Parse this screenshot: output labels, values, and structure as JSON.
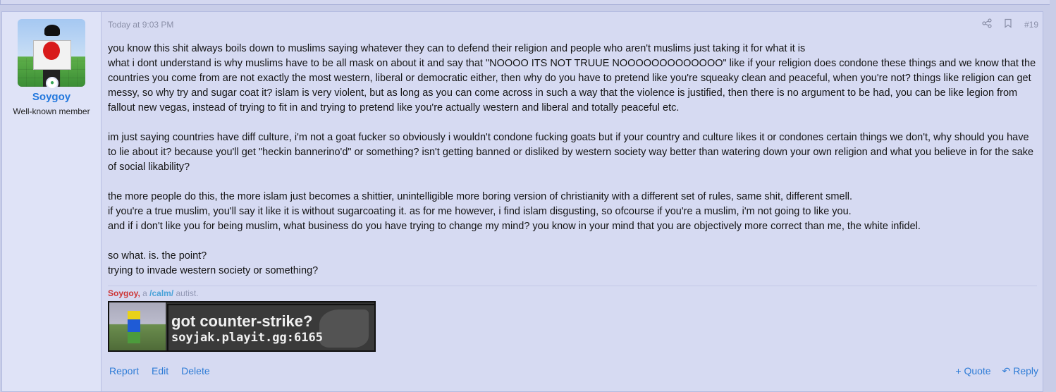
{
  "post": {
    "time": "Today at 9:03 PM",
    "number": "#19",
    "author": {
      "username": "Soygoy",
      "title": "Well-known member"
    },
    "paragraphs": [
      "you know this shit always boils down to muslims saying whatever they can to defend their religion and people who aren't muslims just taking it for what it is",
      "what i dont understand is why muslims have to be all mask on about it and say that \"NOOOO ITS NOT TRUUE NOOOOOOOOOOOOO\" like if your religion does condone these things and we know that the countries you come from are not exactly the most western, liberal or democratic either, then why do you have to pretend like you're squeaky clean and peaceful, when you're not? things like religion can get messy, so why try and sugar coat it? islam is very violent, but as long as you can come across in such a way that the violence is justified, then there is no argument to be had, you can be like legion from fallout new vegas, instead of trying to fit in and trying to pretend like you're actually western and liberal and totally peaceful etc.",
      "",
      "im just saying countries have diff culture, i'm not a goat fucker so obviously i wouldn't condone fucking goats but if your country and culture likes it or condones certain things we don't, why should you have to lie about it? because you'll get \"heckin bannerino'd\" or something? isn't getting banned or disliked by western society way better than watering down your own religion and what you believe in for the sake of social likability?",
      "",
      "the more people do this, the more islam just becomes a shittier, unintelligible more boring version of christianity with a different set of rules, same shit, different smell.",
      "if you're a true muslim, you'll say it like it is without sugarcoating it. as for me however, i find islam disgusting, so ofcourse if you're a muslim, i'm not going to like you.",
      "and if i don't like you for being muslim, what business do you have trying to change my mind? you know in your mind that you are objectively more correct than me, the white infidel.",
      "",
      "so what. is. the point?",
      "trying to invade western society or something?"
    ],
    "signature": {
      "name": "Soygoy,",
      "mid": " a ",
      "link": "/calm/",
      "tail": " autist.",
      "banner_line1": "got counter-strike?",
      "banner_line2": "soyjak.playit.gg:6165"
    },
    "actions": {
      "report": "Report",
      "edit": "Edit",
      "delete": "Delete",
      "quote": "Quote",
      "reply": "Reply"
    },
    "icons": [
      "share-icon",
      "bookmark-icon",
      "online-status-icon",
      "plus-icon",
      "reply-arrow-icon"
    ]
  }
}
